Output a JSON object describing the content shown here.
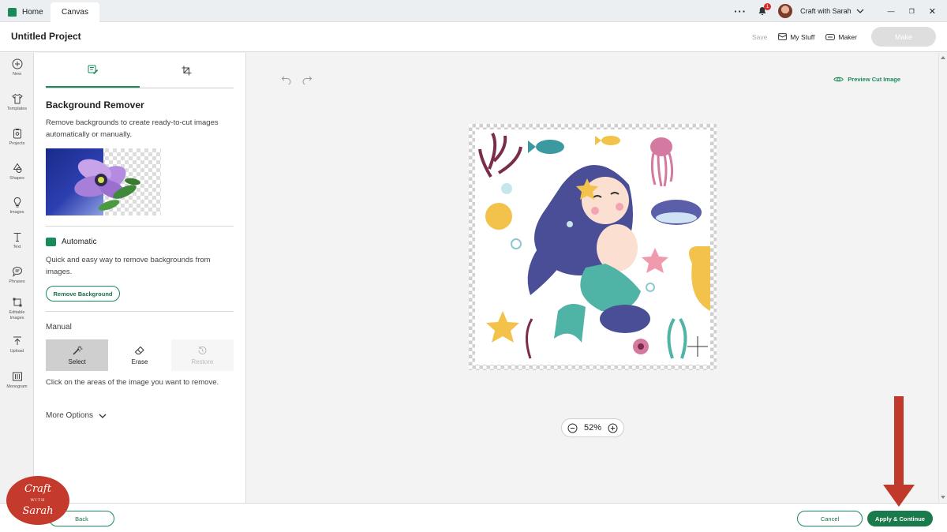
{
  "tabs": {
    "home": "Home",
    "canvas": "Canvas"
  },
  "account": {
    "name": "Craft with Sarah",
    "notifications": "1"
  },
  "header": {
    "title": "Untitled Project",
    "save": "Save",
    "my_stuff": "My Stuff",
    "maker": "Maker",
    "make": "Make"
  },
  "nav": [
    {
      "label": "New",
      "icon": "plus-circle-icon"
    },
    {
      "label": "Templates",
      "icon": "tshirt-icon"
    },
    {
      "label": "Projects",
      "icon": "projects-icon"
    },
    {
      "label": "Shapes",
      "icon": "shapes-icon"
    },
    {
      "label": "Images",
      "icon": "lightbulb-icon"
    },
    {
      "label": "Text",
      "icon": "text-icon"
    },
    {
      "label": "Phrases",
      "icon": "speech-bubble-icon"
    },
    {
      "label": "Editable Images",
      "icon": "editable-image-icon"
    },
    {
      "label": "Upload",
      "icon": "upload-icon"
    },
    {
      "label": "Monogram",
      "icon": "monogram-icon"
    }
  ],
  "panel": {
    "title": "Background Remover",
    "description": "Remove backgrounds to create ready-to-cut images automatically or manually.",
    "automatic_label": "Automatic",
    "automatic_desc": "Quick and easy way to remove backgrounds from images.",
    "remove_button": "Remove Background",
    "manual_label": "Manual",
    "tools": {
      "select": "Select",
      "erase": "Erase",
      "restore": "Restore"
    },
    "manual_desc": "Click on the areas of the image you want to remove.",
    "more_options": "More Options"
  },
  "canvas": {
    "preview": "Preview Cut Image",
    "zoom": "52%"
  },
  "footer": {
    "back": "Back",
    "cancel": "Cancel",
    "apply": "Apply & Continue"
  },
  "logo": {
    "line1": "Craft",
    "small": "WITH",
    "line2": "Sarah"
  },
  "colors": {
    "accent": "#1a8a5a",
    "apply": "#1a7a4c",
    "arrow": "#c0392b",
    "logo": "#c43a2c"
  }
}
